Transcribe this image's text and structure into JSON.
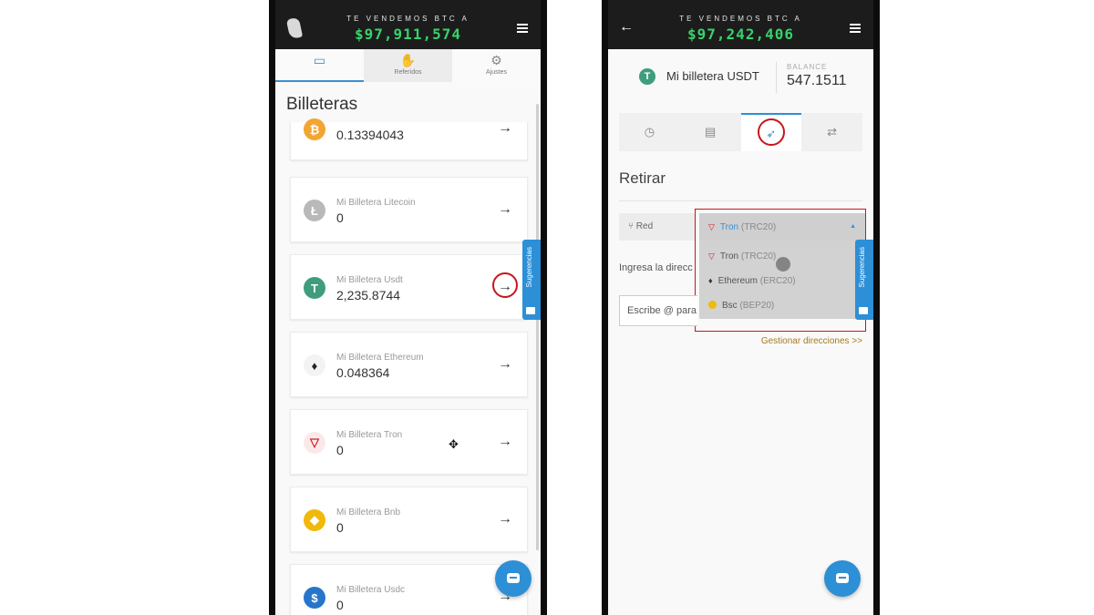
{
  "left_screen": {
    "header": {
      "caption": "TE VENDEMOS BTC A",
      "price": "$97,911,574"
    },
    "tabs": [
      {
        "icon": "wallet-icon",
        "label": ""
      },
      {
        "icon": "handshake-icon",
        "label": "Referidos"
      },
      {
        "icon": "gear-icon",
        "label": "Ajustes"
      }
    ],
    "title": "Billeteras",
    "wallets": [
      {
        "name": "",
        "value": "0.13394043",
        "icon": "bitcoin-icon",
        "color": "#f2a533"
      },
      {
        "name": "Mi Billetera Litecoin",
        "value": "0",
        "icon": "litecoin-icon",
        "color": "#b9b9b9"
      },
      {
        "name": "Mi Billetera Usdt",
        "value": "2,235.8744",
        "icon": "tether-icon",
        "color": "#3f9c7e"
      },
      {
        "name": "Mi Billetera Ethereum",
        "value": "0.048364",
        "icon": "ethereum-icon",
        "color": "#222222"
      },
      {
        "name": "Mi Billetera Tron",
        "value": "0",
        "icon": "tron-icon",
        "color": "#d3222a"
      },
      {
        "name": "Mi Billetera Bnb",
        "value": "0",
        "icon": "bnb-icon",
        "color": "#f0b90b"
      },
      {
        "name": "Mi Billetera Usdc",
        "value": "0",
        "icon": "usdc-icon",
        "color": "#2775ca"
      }
    ],
    "suggestions_label": "Sugerencias"
  },
  "right_screen": {
    "header": {
      "caption": "TE VENDEMOS BTC A",
      "price": "$97,242,406"
    },
    "wallet": {
      "name": "Mi billetera USDT",
      "balance_label": "BALANCE",
      "balance": "547.1511"
    },
    "tabs": [
      "history-icon",
      "deposit-icon",
      "send-icon",
      "swap-icon"
    ],
    "section_title": "Retirar",
    "network_label": "Red",
    "network_selected": {
      "name": "Tron",
      "code": "(TRC20)"
    },
    "network_options": [
      {
        "name": "Tron",
        "code": "(TRC20)",
        "icon": "tron-icon"
      },
      {
        "name": "Ethereum",
        "code": "(ERC20)",
        "icon": "ethereum-icon"
      },
      {
        "name": "Bsc",
        "code": "(BEP20)",
        "icon": "bsc-icon"
      }
    ],
    "address_label": "Ingresa la direcc",
    "address_placeholder": "Escribe @ para",
    "manage_link": "Gestionar direcciones >>",
    "suggestions_label": "Sugerencias"
  },
  "colors": {
    "accent": "#2d8fd6",
    "price_green": "#36d36b",
    "highlight_red": "#c7161c",
    "header_bg": "#1c1c1c"
  }
}
